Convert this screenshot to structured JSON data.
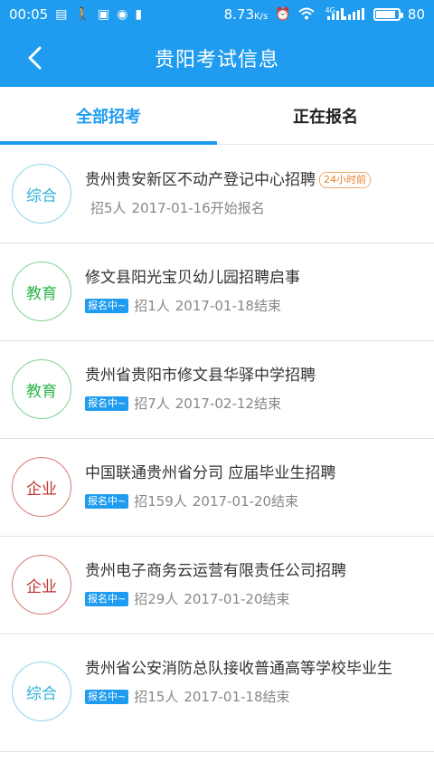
{
  "statusbar": {
    "time": "00:05",
    "speed": "8.73",
    "speed_unit": "K/s",
    "network_badge": "4G",
    "battery_level": "80"
  },
  "header": {
    "title": "贵阳考试信息"
  },
  "tabs": [
    {
      "label": "全部招考",
      "active": true
    },
    {
      "label": "正在报名",
      "active": false
    }
  ],
  "items": [
    {
      "category": "综合",
      "category_color": "#2fb3d8",
      "title": "贵州贵安新区不动产登记中心招聘",
      "new_badge": "24小时前",
      "status": "",
      "count": "招5人",
      "date": "2017-01-16开始报名"
    },
    {
      "category": "教育",
      "category_color": "#2db64b",
      "title": "修文县阳光宝贝幼儿园招聘启事",
      "new_badge": "",
      "status": "报名中~",
      "count": "招1人",
      "date": "2017-01-18结束"
    },
    {
      "category": "教育",
      "category_color": "#2db64b",
      "title": "贵州省贵阳市修文县华驿中学招聘",
      "new_badge": "",
      "status": "报名中~",
      "count": "招7人",
      "date": "2017-02-12结束"
    },
    {
      "category": "企业",
      "category_color": "#c0342c",
      "title": "中国联通贵州省分司 应届毕业生招聘",
      "new_badge": "",
      "status": "报名中~",
      "count": "招159人",
      "date": "2017-01-20结束"
    },
    {
      "category": "企业",
      "category_color": "#c0342c",
      "title": "贵州电子商务云运营有限责任公司招聘",
      "new_badge": "",
      "status": "报名中~",
      "count": "招29人",
      "date": "2017-01-20结束"
    },
    {
      "category": "综合",
      "category_color": "#2fb3d8",
      "title": "贵州省公安消防总队接收普通高等学校毕业生",
      "new_badge": "",
      "status": "报名中~",
      "count": "招15人",
      "date": "2017-01-18结束"
    }
  ]
}
